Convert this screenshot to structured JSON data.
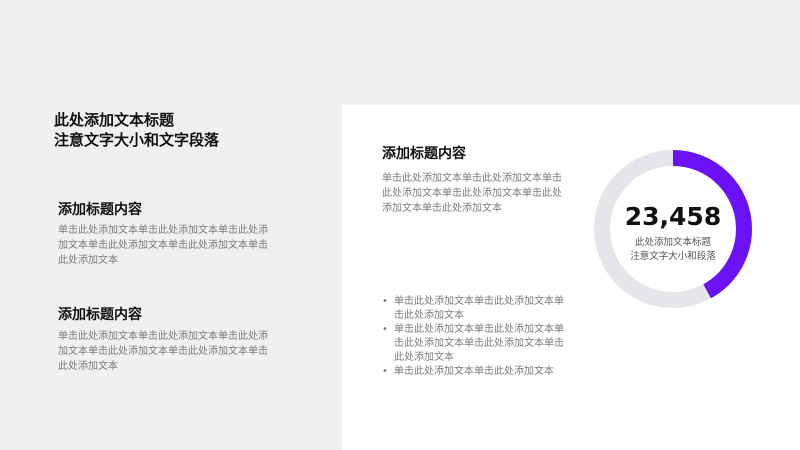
{
  "title": {
    "line1": "此处添加文本标题",
    "line2": "注意文字大小和文字段落"
  },
  "left_blocks": [
    {
      "heading": "添加标题内容",
      "text": "单击此处添加文本单击此处添加文本单击此处添加文本单击此处添加文本单击此处添加文本单击此处添加文本"
    },
    {
      "heading": "添加标题内容",
      "text": "单击此处添加文本单击此处添加文本单击此处添加文本单击此处添加文本单击此处添加文本单击此处添加文本"
    }
  ],
  "right_block": {
    "heading": "添加标题内容",
    "text": "单击此处添加文本单击此处添加文本单击此处添加文本单击此处添加文本单击此处添加文本单击此处添加文本"
  },
  "bullets": [
    "单击此处添加文本单击此处添加文本单击此处添加文本",
    "单击此处添加文本单击此处添加文本单击此处添加文本单击此处添加文本单击此处添加文本",
    "单击此处添加文本单击此处添加文本"
  ],
  "donut": {
    "value_label": "23,458",
    "caption_line1": "此处添加文本标题",
    "caption_line2": "注意文字大小和段落",
    "progress_fraction": 0.42,
    "accent_color": "#6a12f5",
    "track_color": "#e6e6ea"
  }
}
